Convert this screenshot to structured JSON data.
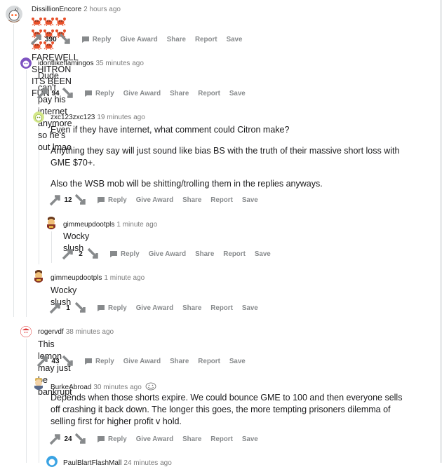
{
  "comments": [
    {
      "author": "DissillionEncore",
      "time": "2 hours ago",
      "body": [
        "FAREWELL SHITRON ITS BEEN FUN"
      ],
      "score": "390"
    },
    {
      "author": "idontlikeflamingos",
      "time": "35 minutes ago",
      "body": [
        "Dude can't pay his internet anymore so he's out lmao"
      ],
      "score": "94"
    },
    {
      "author": "zxc123zxc123",
      "time": "19 minutes ago",
      "body": [
        "Even if they have internet, what comment could Citron make?",
        "Anything they say will just sound like bias BS with the truth of their massive short loss with GME $70+.",
        "Also the WSB mob will be shitting/trolling them in the replies anyways."
      ],
      "score": "12"
    },
    {
      "author": "gimmeupdootpls",
      "time": "1 minute ago",
      "body": [
        "Wocky slush"
      ],
      "score": "2"
    },
    {
      "author": "gimmeupdootpls",
      "time": "1 minute ago",
      "body": [
        "Wocky slush"
      ],
      "score": "1"
    },
    {
      "author": "rogervdf",
      "time": "38 minutes ago",
      "body": [
        "This lemon may just be bankrupt"
      ],
      "score": "43"
    },
    {
      "author": "BurkeAbroad",
      "time": "30 minutes ago",
      "body": [
        "Depends when those shorts expire. We could bounce GME to 100 and then everyone sells off crashing it back down. The longer this goes, the more tempting prisoners dilemma of selling first for higher profit v hold."
      ],
      "score": "24"
    }
  ],
  "partial_comment": {
    "author": "PaulBlartFlashMall",
    "time": "24 minutes ago"
  },
  "actions": {
    "reply": "Reply",
    "award": "Give Award",
    "share": "Share",
    "report": "Report",
    "save": "Save"
  },
  "emoji_count": 8,
  "colors": {
    "meta": "#7c7c7c",
    "action": "#878a8c",
    "thread": "#e2e5e7",
    "crab": "#e8502a"
  }
}
